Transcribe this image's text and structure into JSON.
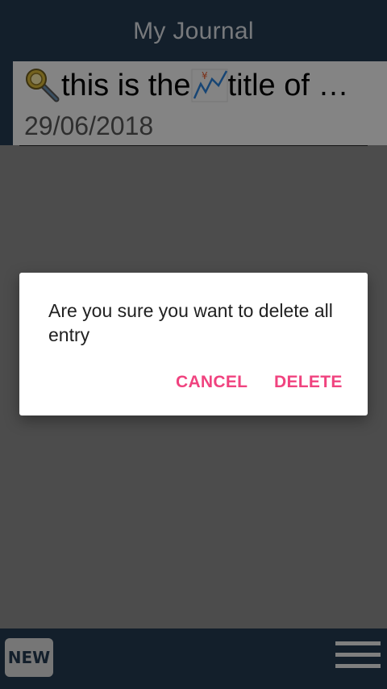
{
  "app": {
    "title": "My Journal"
  },
  "entry": {
    "title_before": "this is the",
    "title_after": " title of …",
    "date": "29/06/2018",
    "leading_icon": "magnifying-glass-icon",
    "inline_icon": "yen-chart-icon"
  },
  "bottom_bar": {
    "new_label": "NEW",
    "menu_icon": "hamburger-menu-icon"
  },
  "dialog": {
    "message": "Are you sure you want to delete all entry",
    "cancel_label": "CANCEL",
    "delete_label": "DELETE"
  },
  "colors": {
    "primary": "#24394f",
    "accent": "#f0437f"
  }
}
